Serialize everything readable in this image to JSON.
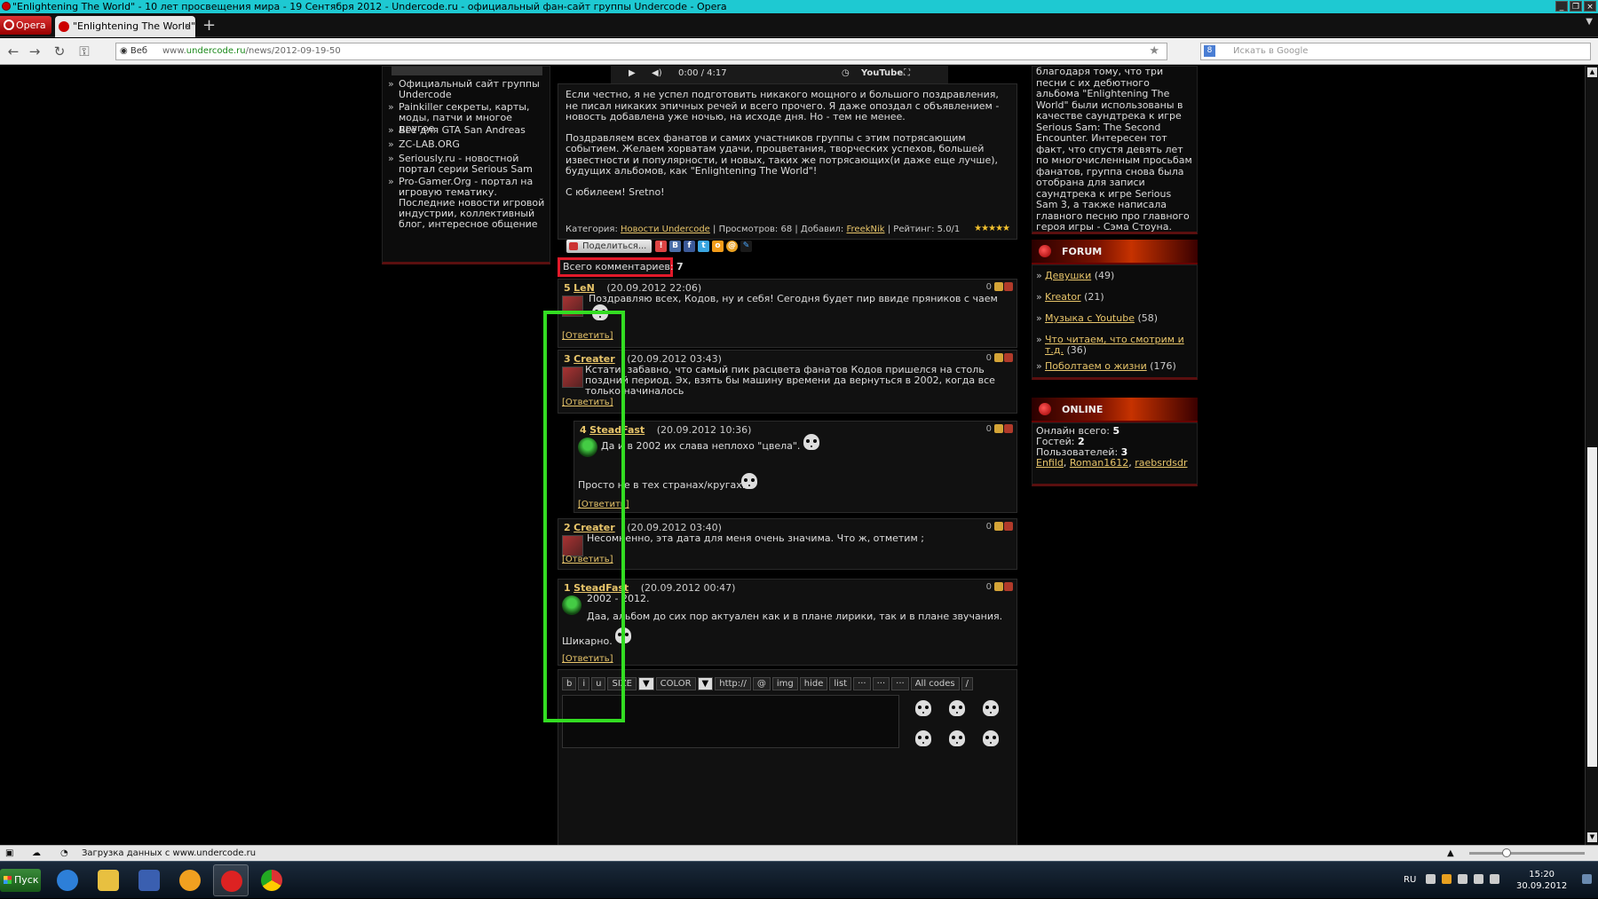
{
  "window": {
    "title": "\"Enlightening The World\" - 10 лет просвещения мира - 19 Сентября 2012 - Undercode.ru - официальный фан-сайт группы Undercode - Opera",
    "controls": [
      "_",
      "❐",
      "×"
    ]
  },
  "tabs": {
    "opera_label": "Opera",
    "items": [
      {
        "label": "\"Enlightening The World\"..."
      }
    ],
    "new_tab": "+"
  },
  "addressbar": {
    "web_label": "Веб",
    "url_prefix": "www.",
    "url_domain": "undercode.ru",
    "url_path": "/news/2012-09-19-50",
    "search_placeholder": "Искать в Google"
  },
  "left_sidebar": {
    "links": [
      "Официальный сайт группы Undercode",
      "Painkiller секреты, карты, моды, патчи и многое другое",
      "Всё для GTA San Andreas",
      "ZC-LAB.ORG",
      "Seriously.ru - новостной портал серии Serious Sam",
      "Pro-Gamer.Org - портал на игровую тематику. Последние новости игровой индустрии, коллективный блог, интересное общение"
    ]
  },
  "player": {
    "time": "0:00 / 4:17",
    "brand": "YouTube"
  },
  "news": {
    "paragraphs": [
      "Если честно, я не успел подготовить никакого мощного и большого поздравления, не писал никаких эпичных речей и всего прочего. Я даже опоздал с объявлением - новость добавлена уже ночью, на исходе дня. Но - тем не менее.",
      "Поздравляем всех фанатов и самих участников группы с этим потрясающим событием. Желаем хорватам удачи, процветания, творческих успехов, большей известности и популярности, и новых, таких же потрясающих(и даже еще лучше), будущих альбомов, как \"Enlightening The World\"!",
      "С юбилеем! Sretno!"
    ],
    "meta": {
      "category_label": "Категория:",
      "category": "Новости Undercode",
      "views_label": "Просмотров:",
      "views": "68",
      "added_label": "Добавил:",
      "added_by": "FreekNik",
      "rating_label": "Рейтинг:",
      "rating": "5.0/1",
      "stars": "★★★★★"
    }
  },
  "share": {
    "label": "Поделиться..."
  },
  "comments_count": {
    "label": "Всего комментариев:",
    "value": "7"
  },
  "comments": [
    {
      "num": "5",
      "author": "LeN",
      "date": "(20.09.2012 22:06)",
      "rating": "0",
      "text": "Поздравляю всех, Кодов, ну и себя! Сегодня будет пир ввиде пряников с чаем",
      "reply": "[Ответить]"
    },
    {
      "num": "3",
      "author": "Creater",
      "date": "(20.09.2012 03:43)",
      "rating": "0",
      "text": "Кстати, забавно, что самый пик расцвета фанатов Кодов пришелся на столь поздний период. Эх, взять бы машину времени да вернуться в 2002, когда все только начиналось",
      "reply": "[Ответить]"
    },
    {
      "num": "4",
      "author": "SteadFast",
      "date": "(20.09.2012 10:36)",
      "rating": "0",
      "text": "Да и в 2002 их слава неплохо \"цвела\".",
      "text2": "Просто не в тех странах/кругах.",
      "reply": "[Ответить]"
    },
    {
      "num": "2",
      "author": "Creater",
      "date": "(20.09.2012 03:40)",
      "rating": "0",
      "text": "Несомненно, эта дата для меня очень значима. Что ж, отметим ;",
      "reply": "[Ответить]"
    },
    {
      "num": "1",
      "author": "SteadFast",
      "date": "(20.09.2012 00:47)",
      "rating": "0",
      "text": "2002 - 2012.",
      "text2": "Даа, альбом до сих пор актуален как и в плане лирики, так и в плане звучания.",
      "text3": "Шикарно.",
      "reply": "[Ответить]"
    }
  ],
  "editor": {
    "buttons": [
      "b",
      "i",
      "u",
      "SIZE",
      "▼",
      "COLOR",
      "▼",
      "http://",
      "@",
      "img",
      "hide",
      "list",
      "···",
      "···",
      "···",
      "All codes",
      "/"
    ]
  },
  "right_sidebar": {
    "intro": "благодаря тому, что три песни с их дебютного альбома \"Enlightening The World\" были использованы в качестве саундтрека к игре Serious Sam: The Second Encounter. Интересен тот факт, что спустя девять лет по многочисленным просьбам фанатов, группа снова была отобрана для записи саундтрека к игре Serious Sam 3, а также написала главного песню про главного героя игры - Сэма Стоуна.",
    "forum": {
      "title": "FORUM",
      "items": [
        {
          "label": "Девушки",
          "count": "(49)"
        },
        {
          "label": "Kreator",
          "count": "(21)"
        },
        {
          "label": "Музыка с Youtube",
          "count": "(58)"
        },
        {
          "label": "Что читаем, что смотрим и т.д.",
          "count": "(36)"
        },
        {
          "label": "Поболтаем о жизни",
          "count": "(176)"
        }
      ]
    },
    "online": {
      "title": "ONLINE",
      "total_label": "Онлайн всего:",
      "total": "5",
      "guests_label": "Гостей:",
      "guests": "2",
      "users_label": "Пользователей:",
      "users": "3",
      "names": [
        "Enfild",
        "Roman1612",
        "raebsrdsdr"
      ]
    }
  },
  "statusbar": {
    "text": "Загрузка данных с www.undercode.ru"
  },
  "taskbar": {
    "start": "Пуск",
    "lang": "RU",
    "time": "15:20",
    "date": "30.09.2012"
  }
}
